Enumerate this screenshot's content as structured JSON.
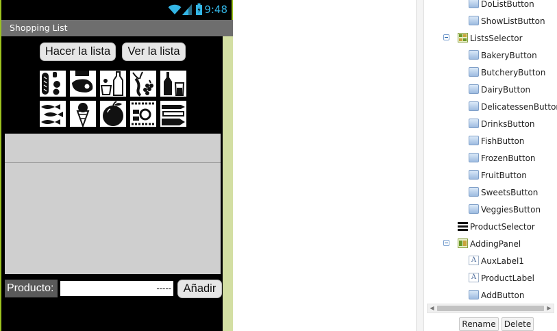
{
  "status_bar": {
    "time": "9:48"
  },
  "app": {
    "title": "Shopping List"
  },
  "toolbar": {
    "make_list": "Hacer la lista",
    "view_list": "Ver la lista"
  },
  "product_icons": [
    "bakery-icon",
    "butchery-icon",
    "dairy-icon",
    "delicatessen-icon",
    "drinks-icon",
    "fish-icon",
    "frozen-icon",
    "fruit-icon",
    "sweets-icon",
    "veggies-icon"
  ],
  "adding_panel": {
    "label": "Producto:",
    "input_value": "-----",
    "add_button": "Añadir"
  },
  "component_tree": [
    {
      "label": "DoListButton",
      "icon": "button-icon"
    },
    {
      "label": "ShowListButton",
      "icon": "button-icon"
    },
    {
      "label": "ListsSelector",
      "icon": "arrangement-icon"
    },
    {
      "label": "BakeryButton",
      "icon": "button-icon"
    },
    {
      "label": "ButcheryButton",
      "icon": "button-icon"
    },
    {
      "label": "DairyButton",
      "icon": "button-icon"
    },
    {
      "label": "DelicatessenButton",
      "icon": "button-icon"
    },
    {
      "label": "DrinksButton",
      "icon": "button-icon"
    },
    {
      "label": "FishButton",
      "icon": "button-icon"
    },
    {
      "label": "FrozenButton",
      "icon": "button-icon"
    },
    {
      "label": "FruitButton",
      "icon": "button-icon"
    },
    {
      "label": "SweetsButton",
      "icon": "button-icon"
    },
    {
      "label": "VeggiesButton",
      "icon": "button-icon"
    },
    {
      "label": "ProductSelector",
      "icon": "listview-icon"
    },
    {
      "label": "AddingPanel",
      "icon": "horizontal-arrangement-icon"
    },
    {
      "label": "AuxLabel1",
      "icon": "label-icon"
    },
    {
      "label": "ProductLabel",
      "icon": "label-icon"
    },
    {
      "label": "AddButton",
      "icon": "button-icon"
    }
  ],
  "tree_actions": {
    "rename": "Rename",
    "delete": "Delete"
  },
  "colors": {
    "status_accent": "#33b5e5",
    "phone_border": "#9cc21f",
    "title_bar": "#6e6e6e",
    "list_area": "#cfcfcf",
    "scroll_strip": "#d3dfa3"
  }
}
